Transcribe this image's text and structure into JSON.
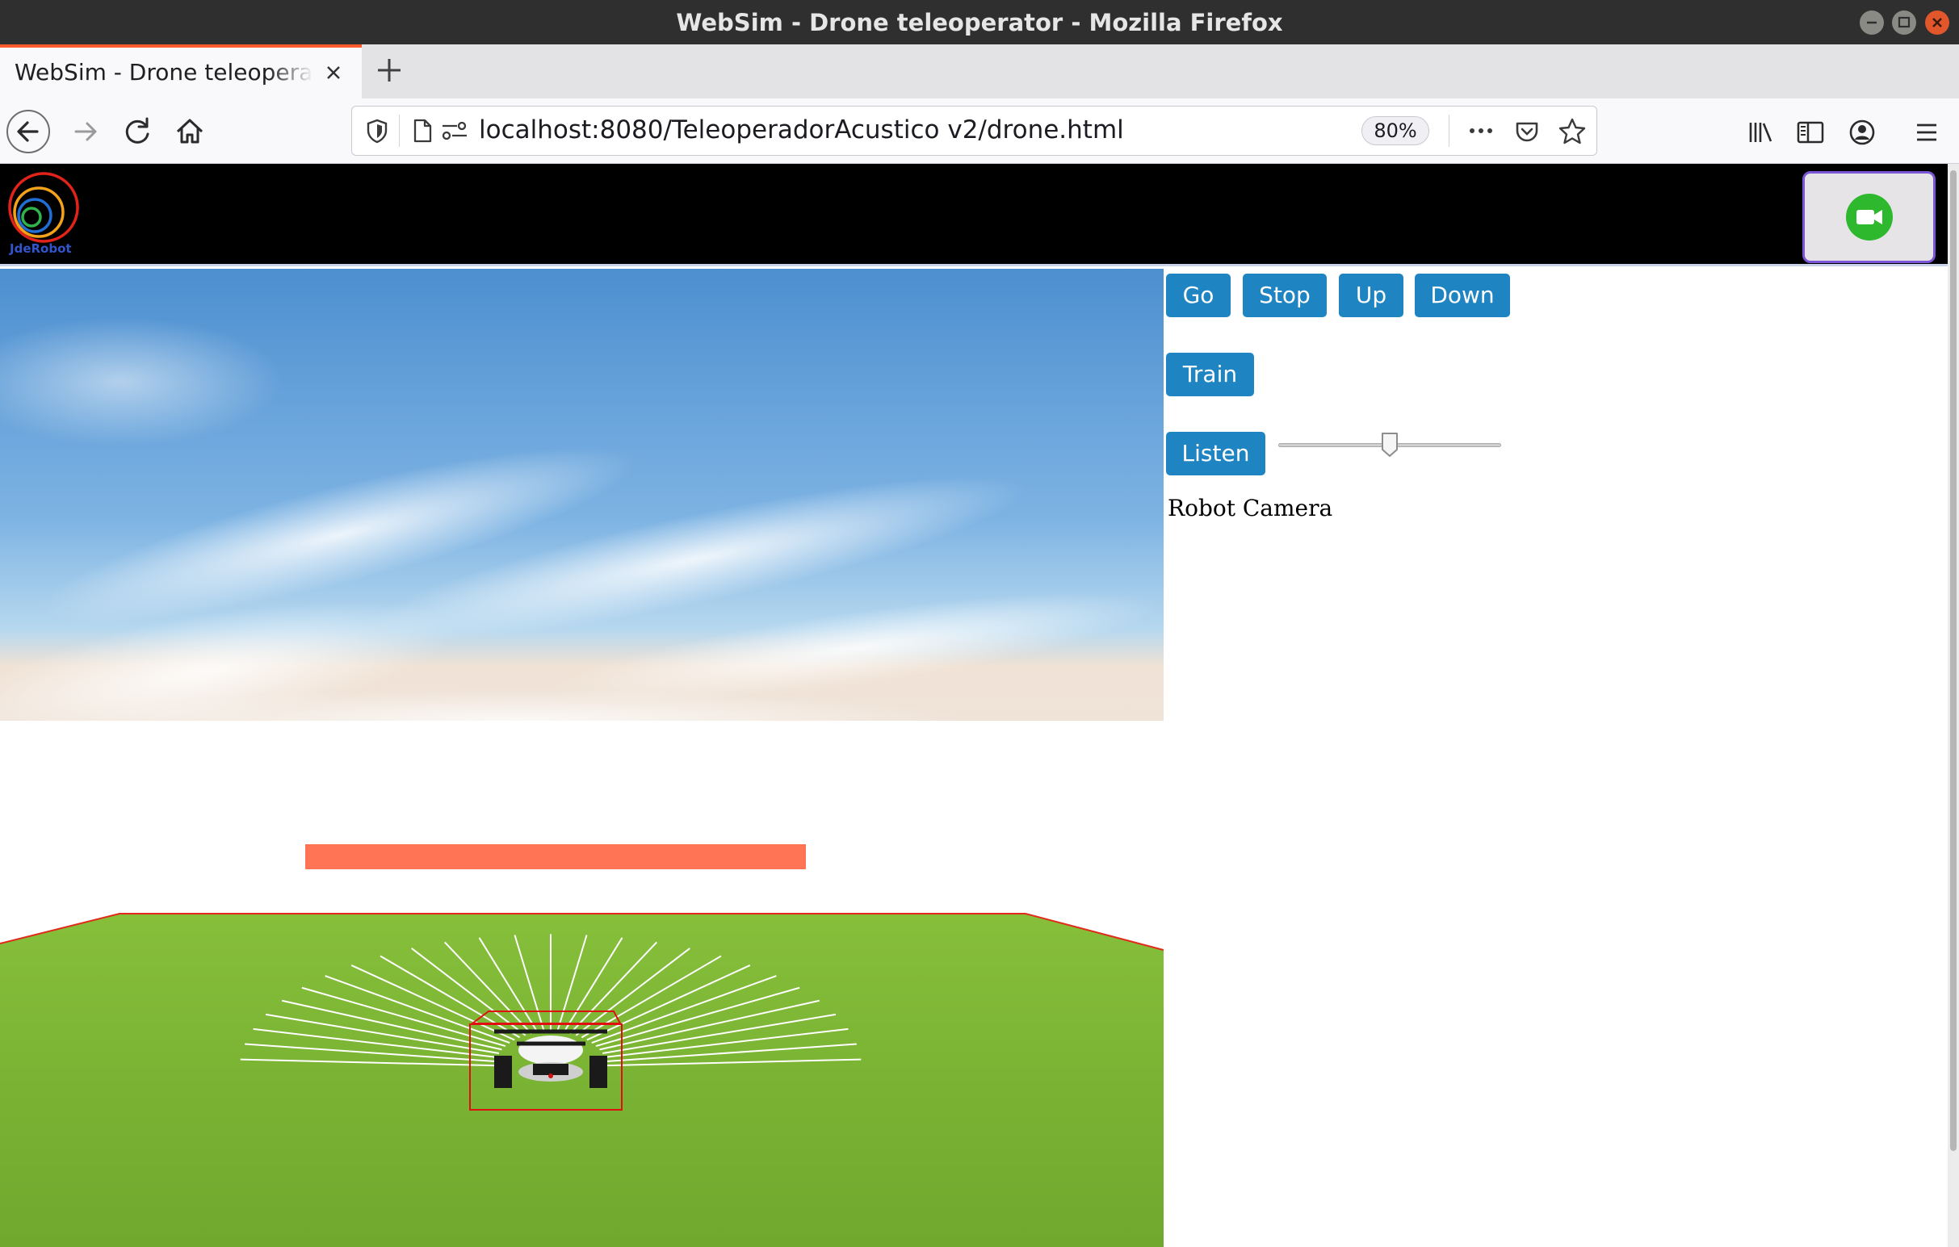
{
  "window": {
    "title": "WebSim - Drone teleoperator - Mozilla Firefox"
  },
  "browser": {
    "tab_title": "WebSim - Drone teleoperator",
    "url": "localhost:8080/TeleoperadorAcustico v2/drone.html",
    "zoom": "80%"
  },
  "page": {
    "logo_text": "JdeRobot",
    "buttons": {
      "go": "Go",
      "stop": "Stop",
      "up": "Up",
      "down": "Down",
      "train": "Train",
      "listen": "Listen"
    },
    "slider": {
      "value_fraction": 0.5
    },
    "robot_camera_label": "Robot Camera",
    "icons": {
      "camera_toggle": "video-camera-icon",
      "logo": "jderobot-logo"
    },
    "colors": {
      "button_bg": "#1f85c2",
      "camera_icon": "#2eb82e",
      "camera_toggle_border": "#7a55d6",
      "tab_accent": "#ff5a2b",
      "sky_top": "#4d8fd0",
      "grass": "#7cb534",
      "obstacle_bar": "#ff7454"
    }
  }
}
